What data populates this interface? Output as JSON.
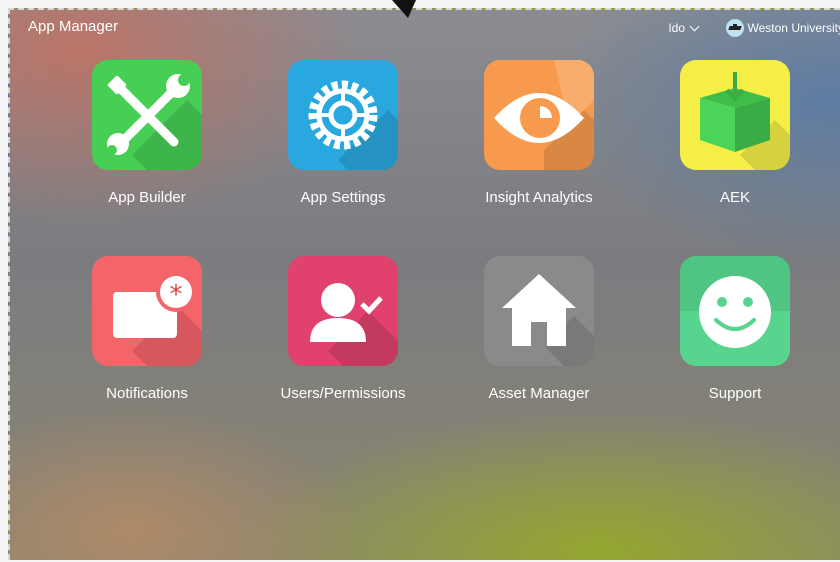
{
  "header": {
    "title": "App Manager",
    "user": "Ido",
    "organization": "Weston University"
  },
  "apps": [
    {
      "label": "App Builder",
      "color": "#47cf55",
      "icon": "tools-icon"
    },
    {
      "label": "App Settings",
      "color": "#29a8e0",
      "icon": "gear-icon"
    },
    {
      "label": "Insight Analytics",
      "color": "#f79a4d",
      "icon": "eye-icon"
    },
    {
      "label": "AEK",
      "color": "#f4ee47",
      "icon": "box-download-icon"
    },
    {
      "label": "Notifications",
      "color": "#f4656a",
      "icon": "notification-icon"
    },
    {
      "label": "Users/Permissions",
      "color": "#e0426d",
      "icon": "user-check-icon"
    },
    {
      "label": "Asset Manager",
      "color": "#8a8a8a",
      "icon": "home-icon"
    },
    {
      "label": "Support",
      "color": "#57d58f",
      "icon": "smiley-icon"
    }
  ]
}
